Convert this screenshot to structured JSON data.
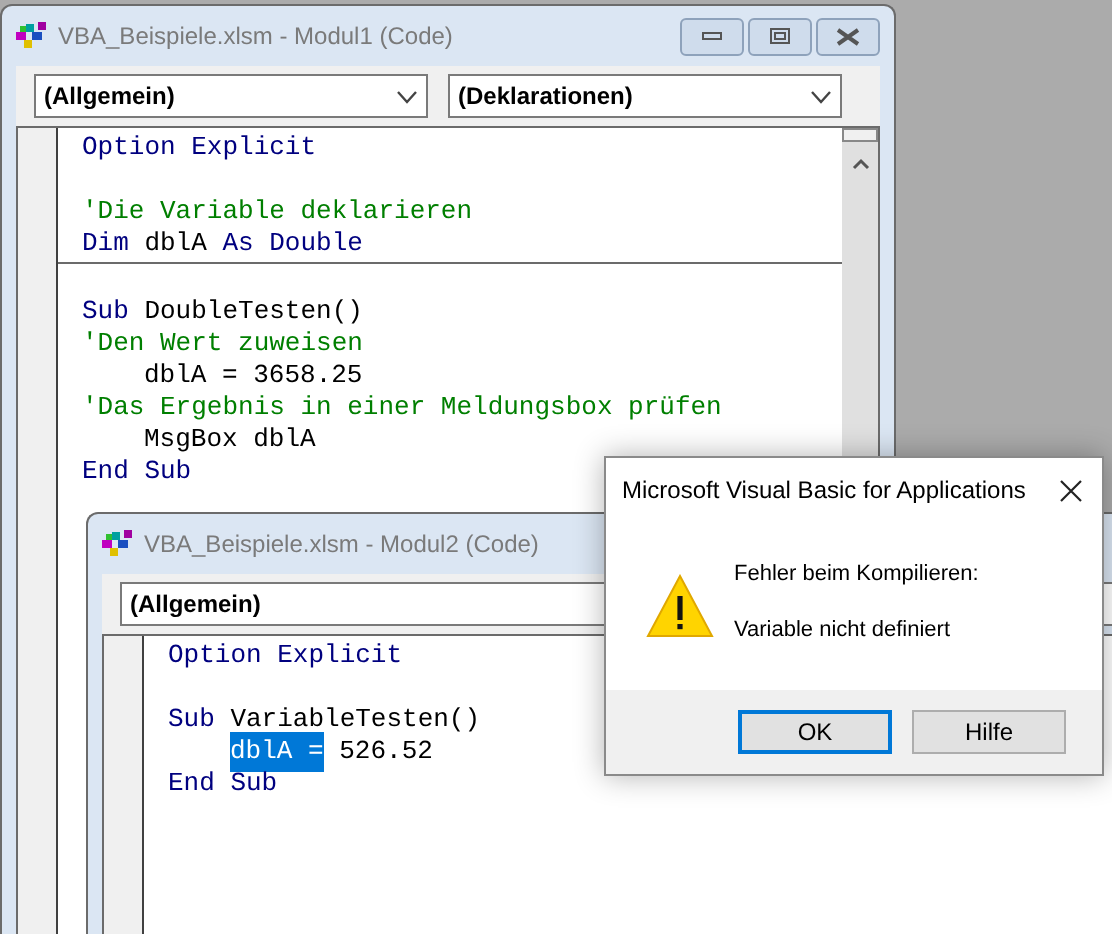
{
  "windows": [
    {
      "title": "VBA_Beispiele.xlsm - Modul1 (Code)",
      "dropdowns": [
        "(Allgemein)",
        "(Deklarationen)"
      ],
      "code_sections": [
        [
          {
            "kind": "code",
            "indented": false,
            "segments": [
              {
                "text": "Option Explicit",
                "kind": "keyword"
              }
            ]
          },
          {
            "kind": "blank"
          },
          {
            "kind": "code",
            "indented": false,
            "segments": [
              {
                "text": "'Die Variable deklarieren",
                "kind": "comment"
              }
            ]
          },
          {
            "kind": "code",
            "indented": false,
            "segments": [
              {
                "text": "Dim",
                "kind": "keyword"
              },
              {
                "text": " dblA ",
                "kind": "plain"
              },
              {
                "text": "As Double",
                "kind": "keyword"
              }
            ]
          }
        ],
        [
          {
            "kind": "blank"
          },
          {
            "kind": "code",
            "indented": false,
            "segments": [
              {
                "text": "Sub",
                "kind": "keyword"
              },
              {
                "text": " DoubleTesten()",
                "kind": "plain"
              }
            ]
          },
          {
            "kind": "code",
            "indented": false,
            "segments": [
              {
                "text": "'Den Wert zuweisen",
                "kind": "comment"
              }
            ]
          },
          {
            "kind": "code",
            "indented": true,
            "segments": [
              {
                "text": "dblA = 3658.25",
                "kind": "plain"
              }
            ]
          },
          {
            "kind": "code",
            "indented": false,
            "segments": [
              {
                "text": "'Das Ergebnis in einer Meldungsbox prüfen",
                "kind": "comment"
              }
            ]
          },
          {
            "kind": "code",
            "indented": true,
            "segments": [
              {
                "text": "MsgBox dblA",
                "kind": "plain"
              }
            ]
          },
          {
            "kind": "code",
            "indented": false,
            "segments": [
              {
                "text": "End Sub",
                "kind": "keyword"
              }
            ]
          }
        ]
      ]
    },
    {
      "title": "VBA_Beispiele.xlsm - Modul2 (Code)",
      "dropdowns": [
        "(Allgemein)"
      ],
      "code_sections": [
        [
          {
            "kind": "code",
            "indented": false,
            "segments": [
              {
                "text": "Option Explicit",
                "kind": "keyword"
              }
            ]
          },
          {
            "kind": "blank"
          },
          {
            "kind": "code",
            "indented": false,
            "segments": [
              {
                "text": "Sub",
                "kind": "keyword"
              },
              {
                "text": " VariableTesten()",
                "kind": "plain"
              }
            ]
          },
          {
            "kind": "code",
            "indented": true,
            "segments": [
              {
                "text": "dblA =",
                "kind": "plain",
                "selected": true
              },
              {
                "text": " 526.52",
                "kind": "plain",
                "selected": false
              }
            ]
          },
          {
            "kind": "code",
            "indented": false,
            "segments": [
              {
                "text": "End Sub",
                "kind": "keyword"
              }
            ]
          }
        ]
      ]
    }
  ],
  "dialog": {
    "title": "Microsoft Visual Basic for Applications",
    "messages": [
      "Fehler beim Kompilieren:",
      "Variable nicht definiert"
    ],
    "buttons": [
      {
        "label": "OK",
        "selected": true
      },
      {
        "label": "Hilfe",
        "selected": false
      }
    ]
  }
}
